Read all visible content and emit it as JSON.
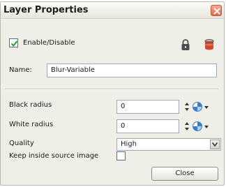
{
  "window": {
    "title": "Layer Properties"
  },
  "enable": {
    "label": "Enable/Disable",
    "checked": true
  },
  "name": {
    "label": "Name:",
    "value": "Blur-Variable"
  },
  "black_radius": {
    "label": "Black radius",
    "value": "0"
  },
  "white_radius": {
    "label": "White radius",
    "value": "0"
  },
  "quality": {
    "label": "Quality",
    "value": "High"
  },
  "keep_inside": {
    "label": "Keep inside source image",
    "checked": false
  },
  "buttons": {
    "close": "Close"
  },
  "icons": {
    "lock": "lock-icon",
    "color": "paint-bucket-icon",
    "stepper": "up-down-arrows-icon",
    "function": "function-curve-icon",
    "dropdown": "chevron-down-icon",
    "close": "close-icon"
  },
  "colors": {
    "accent": "#4a6f9a",
    "close_button": "#e36a4d"
  }
}
